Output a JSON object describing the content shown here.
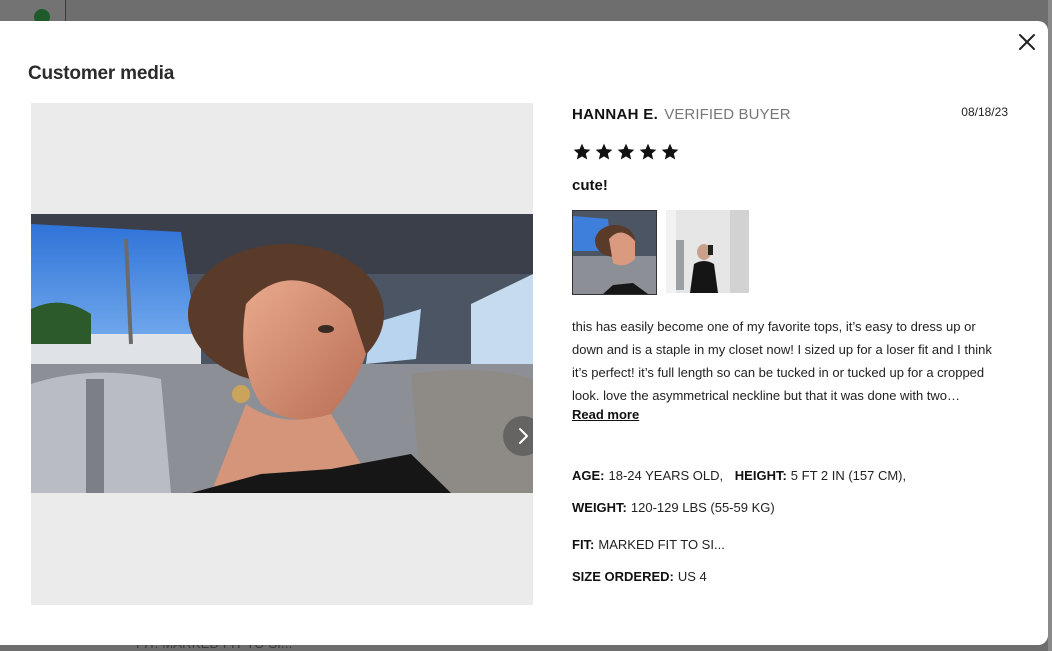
{
  "background": {
    "behind_text": "FIT: MARKED FIT TO SI..."
  },
  "modal": {
    "title": "Customer media",
    "close_icon": "close-icon",
    "next_icon": "chevron-right-icon"
  },
  "review": {
    "reviewer_name": "HANNAH E.",
    "verified_label": "VERIFIED BUYER",
    "date": "08/18/23",
    "rating": 5,
    "max_rating": 5,
    "title": "cute!",
    "body": "this has easily become one of my favorite tops, it’s easy to dress up or down and is a staple in my closet now! I sized up for a loser fit and I think it’s perfect! it’s full length so can be tucked in or tucked up for a cropped look. love the asymmetrical neckline but that it was done with two…",
    "read_more_label": "Read more",
    "attributes": {
      "age_key": "AGE:",
      "age_val": "18-24 YEARS OLD,",
      "height_key": "HEIGHT:",
      "height_val": "5 FT 2 IN (157 CM),",
      "weight_key": "WEIGHT:",
      "weight_val": "120-129 LBS (55-59 KG)",
      "fit_key": "FIT:",
      "fit_val": "MARKED FIT TO SI...",
      "size_key": "SIZE ORDERED:",
      "size_val": "US 4"
    }
  },
  "colors": {
    "overlay": "#6e6e6e",
    "media_bg": "#ebebeb",
    "text": "#111111",
    "muted": "#777777"
  }
}
